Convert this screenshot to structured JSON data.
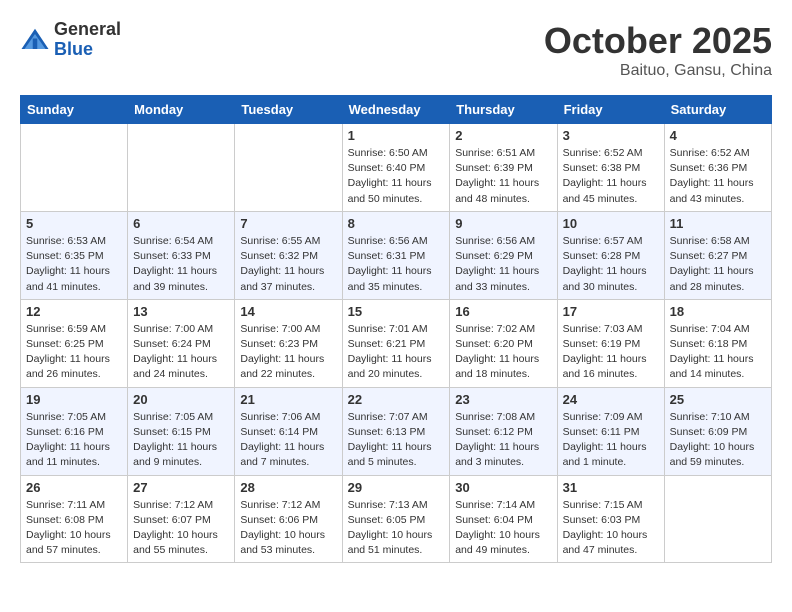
{
  "header": {
    "logo_general": "General",
    "logo_blue": "Blue",
    "month_title": "October 2025",
    "location": "Baituo, Gansu, China"
  },
  "weekdays": [
    "Sunday",
    "Monday",
    "Tuesday",
    "Wednesday",
    "Thursday",
    "Friday",
    "Saturday"
  ],
  "weeks": [
    [
      {
        "day": "",
        "info": ""
      },
      {
        "day": "",
        "info": ""
      },
      {
        "day": "",
        "info": ""
      },
      {
        "day": "1",
        "info": "Sunrise: 6:50 AM\nSunset: 6:40 PM\nDaylight: 11 hours\nand 50 minutes."
      },
      {
        "day": "2",
        "info": "Sunrise: 6:51 AM\nSunset: 6:39 PM\nDaylight: 11 hours\nand 48 minutes."
      },
      {
        "day": "3",
        "info": "Sunrise: 6:52 AM\nSunset: 6:38 PM\nDaylight: 11 hours\nand 45 minutes."
      },
      {
        "day": "4",
        "info": "Sunrise: 6:52 AM\nSunset: 6:36 PM\nDaylight: 11 hours\nand 43 minutes."
      }
    ],
    [
      {
        "day": "5",
        "info": "Sunrise: 6:53 AM\nSunset: 6:35 PM\nDaylight: 11 hours\nand 41 minutes."
      },
      {
        "day": "6",
        "info": "Sunrise: 6:54 AM\nSunset: 6:33 PM\nDaylight: 11 hours\nand 39 minutes."
      },
      {
        "day": "7",
        "info": "Sunrise: 6:55 AM\nSunset: 6:32 PM\nDaylight: 11 hours\nand 37 minutes."
      },
      {
        "day": "8",
        "info": "Sunrise: 6:56 AM\nSunset: 6:31 PM\nDaylight: 11 hours\nand 35 minutes."
      },
      {
        "day": "9",
        "info": "Sunrise: 6:56 AM\nSunset: 6:29 PM\nDaylight: 11 hours\nand 33 minutes."
      },
      {
        "day": "10",
        "info": "Sunrise: 6:57 AM\nSunset: 6:28 PM\nDaylight: 11 hours\nand 30 minutes."
      },
      {
        "day": "11",
        "info": "Sunrise: 6:58 AM\nSunset: 6:27 PM\nDaylight: 11 hours\nand 28 minutes."
      }
    ],
    [
      {
        "day": "12",
        "info": "Sunrise: 6:59 AM\nSunset: 6:25 PM\nDaylight: 11 hours\nand 26 minutes."
      },
      {
        "day": "13",
        "info": "Sunrise: 7:00 AM\nSunset: 6:24 PM\nDaylight: 11 hours\nand 24 minutes."
      },
      {
        "day": "14",
        "info": "Sunrise: 7:00 AM\nSunset: 6:23 PM\nDaylight: 11 hours\nand 22 minutes."
      },
      {
        "day": "15",
        "info": "Sunrise: 7:01 AM\nSunset: 6:21 PM\nDaylight: 11 hours\nand 20 minutes."
      },
      {
        "day": "16",
        "info": "Sunrise: 7:02 AM\nSunset: 6:20 PM\nDaylight: 11 hours\nand 18 minutes."
      },
      {
        "day": "17",
        "info": "Sunrise: 7:03 AM\nSunset: 6:19 PM\nDaylight: 11 hours\nand 16 minutes."
      },
      {
        "day": "18",
        "info": "Sunrise: 7:04 AM\nSunset: 6:18 PM\nDaylight: 11 hours\nand 14 minutes."
      }
    ],
    [
      {
        "day": "19",
        "info": "Sunrise: 7:05 AM\nSunset: 6:16 PM\nDaylight: 11 hours\nand 11 minutes."
      },
      {
        "day": "20",
        "info": "Sunrise: 7:05 AM\nSunset: 6:15 PM\nDaylight: 11 hours\nand 9 minutes."
      },
      {
        "day": "21",
        "info": "Sunrise: 7:06 AM\nSunset: 6:14 PM\nDaylight: 11 hours\nand 7 minutes."
      },
      {
        "day": "22",
        "info": "Sunrise: 7:07 AM\nSunset: 6:13 PM\nDaylight: 11 hours\nand 5 minutes."
      },
      {
        "day": "23",
        "info": "Sunrise: 7:08 AM\nSunset: 6:12 PM\nDaylight: 11 hours\nand 3 minutes."
      },
      {
        "day": "24",
        "info": "Sunrise: 7:09 AM\nSunset: 6:11 PM\nDaylight: 11 hours\nand 1 minute."
      },
      {
        "day": "25",
        "info": "Sunrise: 7:10 AM\nSunset: 6:09 PM\nDaylight: 10 hours\nand 59 minutes."
      }
    ],
    [
      {
        "day": "26",
        "info": "Sunrise: 7:11 AM\nSunset: 6:08 PM\nDaylight: 10 hours\nand 57 minutes."
      },
      {
        "day": "27",
        "info": "Sunrise: 7:12 AM\nSunset: 6:07 PM\nDaylight: 10 hours\nand 55 minutes."
      },
      {
        "day": "28",
        "info": "Sunrise: 7:12 AM\nSunset: 6:06 PM\nDaylight: 10 hours\nand 53 minutes."
      },
      {
        "day": "29",
        "info": "Sunrise: 7:13 AM\nSunset: 6:05 PM\nDaylight: 10 hours\nand 51 minutes."
      },
      {
        "day": "30",
        "info": "Sunrise: 7:14 AM\nSunset: 6:04 PM\nDaylight: 10 hours\nand 49 minutes."
      },
      {
        "day": "31",
        "info": "Sunrise: 7:15 AM\nSunset: 6:03 PM\nDaylight: 10 hours\nand 47 minutes."
      },
      {
        "day": "",
        "info": ""
      }
    ]
  ]
}
